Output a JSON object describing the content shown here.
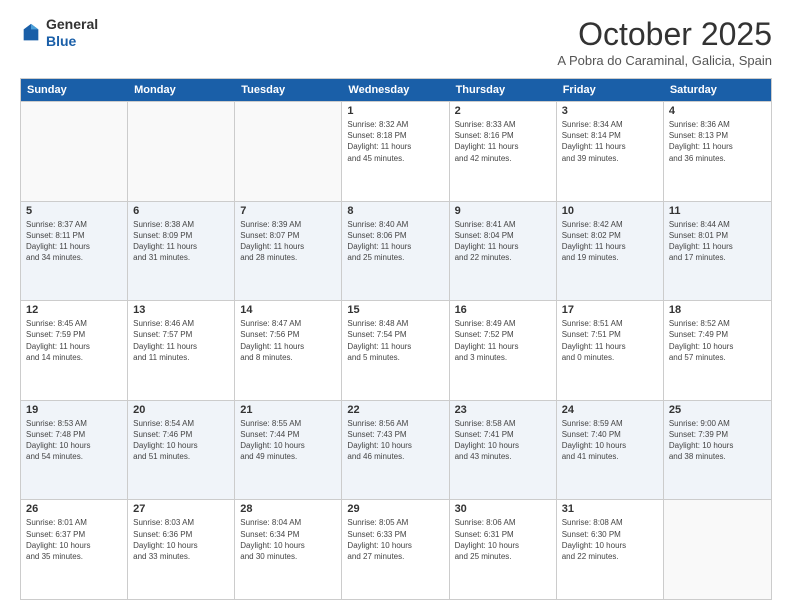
{
  "logo": {
    "general": "General",
    "blue": "Blue"
  },
  "header": {
    "month": "October 2025",
    "location": "A Pobra do Caraminal, Galicia, Spain"
  },
  "day_names": [
    "Sunday",
    "Monday",
    "Tuesday",
    "Wednesday",
    "Thursday",
    "Friday",
    "Saturday"
  ],
  "rows": [
    [
      {
        "date": "",
        "info": ""
      },
      {
        "date": "",
        "info": ""
      },
      {
        "date": "",
        "info": ""
      },
      {
        "date": "1",
        "info": "Sunrise: 8:32 AM\nSunset: 8:18 PM\nDaylight: 11 hours\nand 45 minutes."
      },
      {
        "date": "2",
        "info": "Sunrise: 8:33 AM\nSunset: 8:16 PM\nDaylight: 11 hours\nand 42 minutes."
      },
      {
        "date": "3",
        "info": "Sunrise: 8:34 AM\nSunset: 8:14 PM\nDaylight: 11 hours\nand 39 minutes."
      },
      {
        "date": "4",
        "info": "Sunrise: 8:36 AM\nSunset: 8:13 PM\nDaylight: 11 hours\nand 36 minutes."
      }
    ],
    [
      {
        "date": "5",
        "info": "Sunrise: 8:37 AM\nSunset: 8:11 PM\nDaylight: 11 hours\nand 34 minutes."
      },
      {
        "date": "6",
        "info": "Sunrise: 8:38 AM\nSunset: 8:09 PM\nDaylight: 11 hours\nand 31 minutes."
      },
      {
        "date": "7",
        "info": "Sunrise: 8:39 AM\nSunset: 8:07 PM\nDaylight: 11 hours\nand 28 minutes."
      },
      {
        "date": "8",
        "info": "Sunrise: 8:40 AM\nSunset: 8:06 PM\nDaylight: 11 hours\nand 25 minutes."
      },
      {
        "date": "9",
        "info": "Sunrise: 8:41 AM\nSunset: 8:04 PM\nDaylight: 11 hours\nand 22 minutes."
      },
      {
        "date": "10",
        "info": "Sunrise: 8:42 AM\nSunset: 8:02 PM\nDaylight: 11 hours\nand 19 minutes."
      },
      {
        "date": "11",
        "info": "Sunrise: 8:44 AM\nSunset: 8:01 PM\nDaylight: 11 hours\nand 17 minutes."
      }
    ],
    [
      {
        "date": "12",
        "info": "Sunrise: 8:45 AM\nSunset: 7:59 PM\nDaylight: 11 hours\nand 14 minutes."
      },
      {
        "date": "13",
        "info": "Sunrise: 8:46 AM\nSunset: 7:57 PM\nDaylight: 11 hours\nand 11 minutes."
      },
      {
        "date": "14",
        "info": "Sunrise: 8:47 AM\nSunset: 7:56 PM\nDaylight: 11 hours\nand 8 minutes."
      },
      {
        "date": "15",
        "info": "Sunrise: 8:48 AM\nSunset: 7:54 PM\nDaylight: 11 hours\nand 5 minutes."
      },
      {
        "date": "16",
        "info": "Sunrise: 8:49 AM\nSunset: 7:52 PM\nDaylight: 11 hours\nand 3 minutes."
      },
      {
        "date": "17",
        "info": "Sunrise: 8:51 AM\nSunset: 7:51 PM\nDaylight: 11 hours\nand 0 minutes."
      },
      {
        "date": "18",
        "info": "Sunrise: 8:52 AM\nSunset: 7:49 PM\nDaylight: 10 hours\nand 57 minutes."
      }
    ],
    [
      {
        "date": "19",
        "info": "Sunrise: 8:53 AM\nSunset: 7:48 PM\nDaylight: 10 hours\nand 54 minutes."
      },
      {
        "date": "20",
        "info": "Sunrise: 8:54 AM\nSunset: 7:46 PM\nDaylight: 10 hours\nand 51 minutes."
      },
      {
        "date": "21",
        "info": "Sunrise: 8:55 AM\nSunset: 7:44 PM\nDaylight: 10 hours\nand 49 minutes."
      },
      {
        "date": "22",
        "info": "Sunrise: 8:56 AM\nSunset: 7:43 PM\nDaylight: 10 hours\nand 46 minutes."
      },
      {
        "date": "23",
        "info": "Sunrise: 8:58 AM\nSunset: 7:41 PM\nDaylight: 10 hours\nand 43 minutes."
      },
      {
        "date": "24",
        "info": "Sunrise: 8:59 AM\nSunset: 7:40 PM\nDaylight: 10 hours\nand 41 minutes."
      },
      {
        "date": "25",
        "info": "Sunrise: 9:00 AM\nSunset: 7:39 PM\nDaylight: 10 hours\nand 38 minutes."
      }
    ],
    [
      {
        "date": "26",
        "info": "Sunrise: 8:01 AM\nSunset: 6:37 PM\nDaylight: 10 hours\nand 35 minutes."
      },
      {
        "date": "27",
        "info": "Sunrise: 8:03 AM\nSunset: 6:36 PM\nDaylight: 10 hours\nand 33 minutes."
      },
      {
        "date": "28",
        "info": "Sunrise: 8:04 AM\nSunset: 6:34 PM\nDaylight: 10 hours\nand 30 minutes."
      },
      {
        "date": "29",
        "info": "Sunrise: 8:05 AM\nSunset: 6:33 PM\nDaylight: 10 hours\nand 27 minutes."
      },
      {
        "date": "30",
        "info": "Sunrise: 8:06 AM\nSunset: 6:31 PM\nDaylight: 10 hours\nand 25 minutes."
      },
      {
        "date": "31",
        "info": "Sunrise: 8:08 AM\nSunset: 6:30 PM\nDaylight: 10 hours\nand 22 minutes."
      },
      {
        "date": "",
        "info": ""
      }
    ]
  ]
}
